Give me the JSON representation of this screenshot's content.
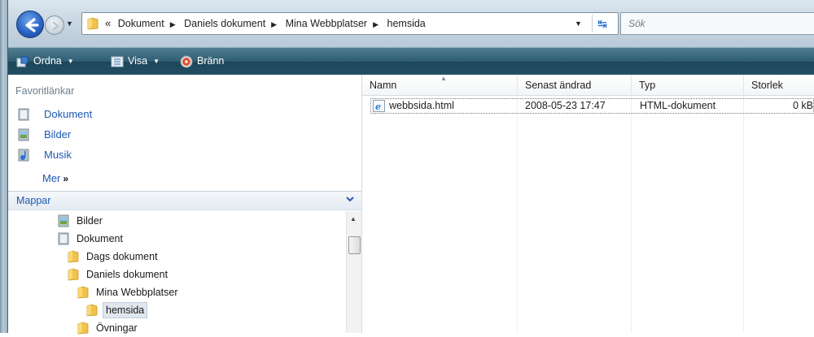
{
  "address": {
    "more_glyph": "«",
    "crumbs": [
      "Dokument",
      "Daniels dokument",
      "Mina Webbplatser",
      "hemsida"
    ]
  },
  "search": {
    "placeholder": "Sök"
  },
  "toolbar": {
    "organize_label": "Ordna",
    "view_label": "Visa",
    "burn_label": "Bränn"
  },
  "favorites": {
    "header": "Favoritlänkar",
    "items": [
      {
        "label": "Dokument",
        "icon": "documents-icon"
      },
      {
        "label": "Bilder",
        "icon": "pictures-icon"
      },
      {
        "label": "Musik",
        "icon": "music-icon"
      }
    ],
    "more_label": "Mer",
    "more_glyph": "»"
  },
  "folders": {
    "header": "Mappar",
    "tree": [
      {
        "label": "Bilder",
        "icon": "pictures-icon"
      },
      {
        "label": "Dokument",
        "icon": "documents-icon"
      },
      {
        "label": "Dags dokument",
        "icon": "folder-icon"
      },
      {
        "label": "Daniels dokument",
        "icon": "folder-icon"
      },
      {
        "label": "Mina Webbplatser",
        "icon": "folder-icon"
      },
      {
        "label": "hemsida",
        "icon": "folder-icon",
        "selected": true
      },
      {
        "label": "Övningar",
        "icon": "folder-icon"
      }
    ]
  },
  "files": {
    "columns": [
      "Namn",
      "Senast ändrad",
      "Typ",
      "Storlek"
    ],
    "rows": [
      {
        "name": "webbsida.html",
        "modified": "2008-05-23 17:47",
        "type": "HTML-dokument",
        "size": "0 kB",
        "icon": "ie-html-icon"
      }
    ]
  },
  "colors": {
    "link_blue": "#1c58b0",
    "toolbar_dark": "#234f63",
    "folder_yellow": "#f2c24a"
  }
}
